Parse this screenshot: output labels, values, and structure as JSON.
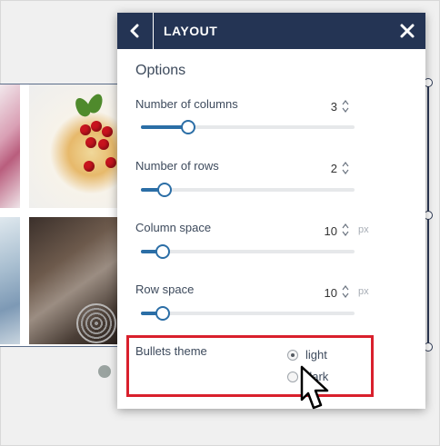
{
  "panel": {
    "title": "LAYOUT",
    "back_icon": "chevron-left-icon",
    "close_icon": "close-icon",
    "header_color": "#243454"
  },
  "options": {
    "section_title": "Options",
    "columns": {
      "label": "Number of columns",
      "value": "3",
      "unit": "",
      "fill": 0.22
    },
    "rows": {
      "label": "Number of rows",
      "value": "2",
      "unit": "",
      "fill": 0.11
    },
    "column_space": {
      "label": "Column space",
      "value": "10",
      "unit": "px",
      "fill": 0.1
    },
    "row_space": {
      "label": "Row space",
      "value": "10",
      "unit": "px",
      "fill": 0.1
    },
    "bullets_theme": {
      "label": "Bullets theme",
      "choices": [
        {
          "label": "light",
          "checked": true
        },
        {
          "label": "dark",
          "checked": false
        }
      ]
    }
  },
  "colors": {
    "accent": "#2b6ea6",
    "highlight": "#d9202c"
  }
}
